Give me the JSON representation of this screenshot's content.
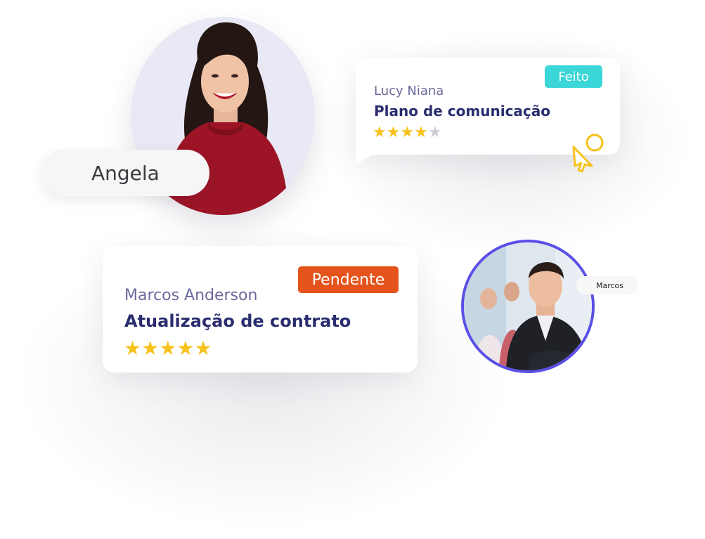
{
  "people": {
    "angela": {
      "label": "Angela"
    },
    "marcos": {
      "label": "Marcos"
    }
  },
  "card_top": {
    "name": "Lucy Niana",
    "task": "Plano de comunicação",
    "status": "Feito",
    "status_color": "#3ad6d8",
    "rating": 4,
    "rating_max": 5
  },
  "card_bottom": {
    "name": "Marcos Anderson",
    "task": "Atualização de contrato",
    "status": "Pendente",
    "status_color": "#e4531b",
    "rating": 5,
    "rating_max": 5
  },
  "colors": {
    "star_filled": "#f7c21e",
    "star_empty": "#cfcfd4",
    "name_text": "#6b6a9c",
    "title_text": "#2a2d6e",
    "avatar_ring": "#5a4fe6",
    "cursor": "#f7c21e"
  },
  "icons": {
    "cursor": "pointer-cursor-icon",
    "star": "star-icon"
  }
}
